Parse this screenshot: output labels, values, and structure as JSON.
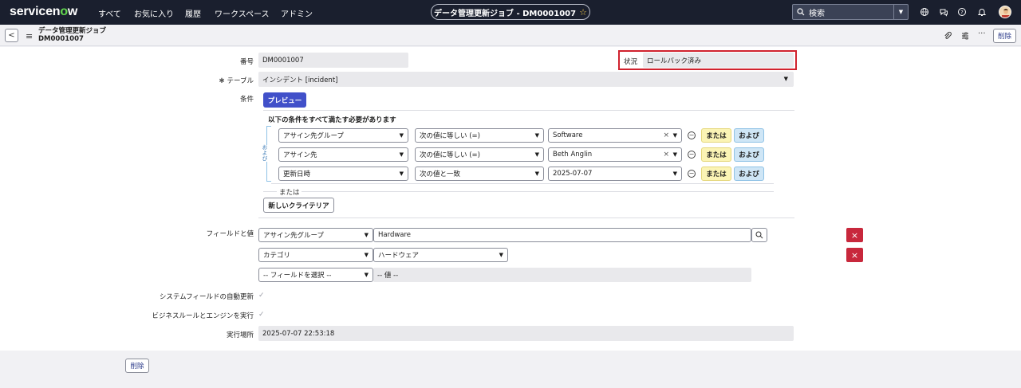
{
  "nav": {
    "logo_a": "servicen",
    "logo_o": "o",
    "logo_b": "w",
    "links": [
      "すべて",
      "お気に入り",
      "履歴",
      "ワークスペース",
      "アドミン"
    ],
    "title": "データ管理更新ジョブ - DM0001007",
    "search_placeholder": "検索"
  },
  "header": {
    "record_type": "データ管理更新ジョブ",
    "record_number": "DM0001007",
    "delete_label": "削除"
  },
  "form": {
    "number_label": "番号",
    "number_value": "DM0001007",
    "status_label": "状況",
    "status_value": "ロールバック済み",
    "table_label": "テーブル",
    "table_required_mark": "✱",
    "table_value": "インシデント [incident]",
    "condition_label": "条件",
    "preview_label": "プレビュー",
    "condition_heading": "以下の条件をすべて満たす必要があります",
    "and_vertical": "および",
    "conditions": [
      {
        "field": "アサイン先グループ",
        "operator": "次の値に等しい (=)",
        "value": "Software"
      },
      {
        "field": "アサイン先",
        "operator": "次の値に等しい (=)",
        "value": "Beth Anglin"
      },
      {
        "field": "更新日時",
        "operator": "次の値と一致",
        "value": "2025-07-07"
      }
    ],
    "or_label": "または",
    "and_label": "および",
    "or_divider": "または",
    "new_criteria_label": "新しいクライテリア",
    "fields_label": "フィールドと値",
    "field_rows": [
      {
        "field": "アサイン先グループ",
        "value": "Hardware"
      },
      {
        "field": "カテゴリ",
        "value": "ハードウェア"
      },
      {
        "field": "-- フィールドを選択 --",
        "value": "-- 値 --"
      }
    ],
    "auto_sys_label": "システムフィールドの自動更新",
    "business_rules_label": "ビジネスルールとエンジンを実行",
    "run_at_label": "実行場所",
    "run_at_value": "2025-07-07 22:53:18",
    "bottom_delete_label": "削除"
  },
  "colors": {
    "nav_bg": "#1a1f2e",
    "brand_green": "#62d84e",
    "primary_button": "#4150c9",
    "highlight_border": "#d0222e",
    "or_button": "#fbf4b5",
    "and_button": "#cfe6f6",
    "remove_button": "#c8283c"
  },
  "icons": [
    "globe-icon",
    "chat-icon",
    "help-icon",
    "bell-icon",
    "attachment-icon",
    "settings-sliders-icon",
    "more-icon",
    "search-icon",
    "hamburger-icon",
    "back-icon",
    "close-icon"
  ]
}
